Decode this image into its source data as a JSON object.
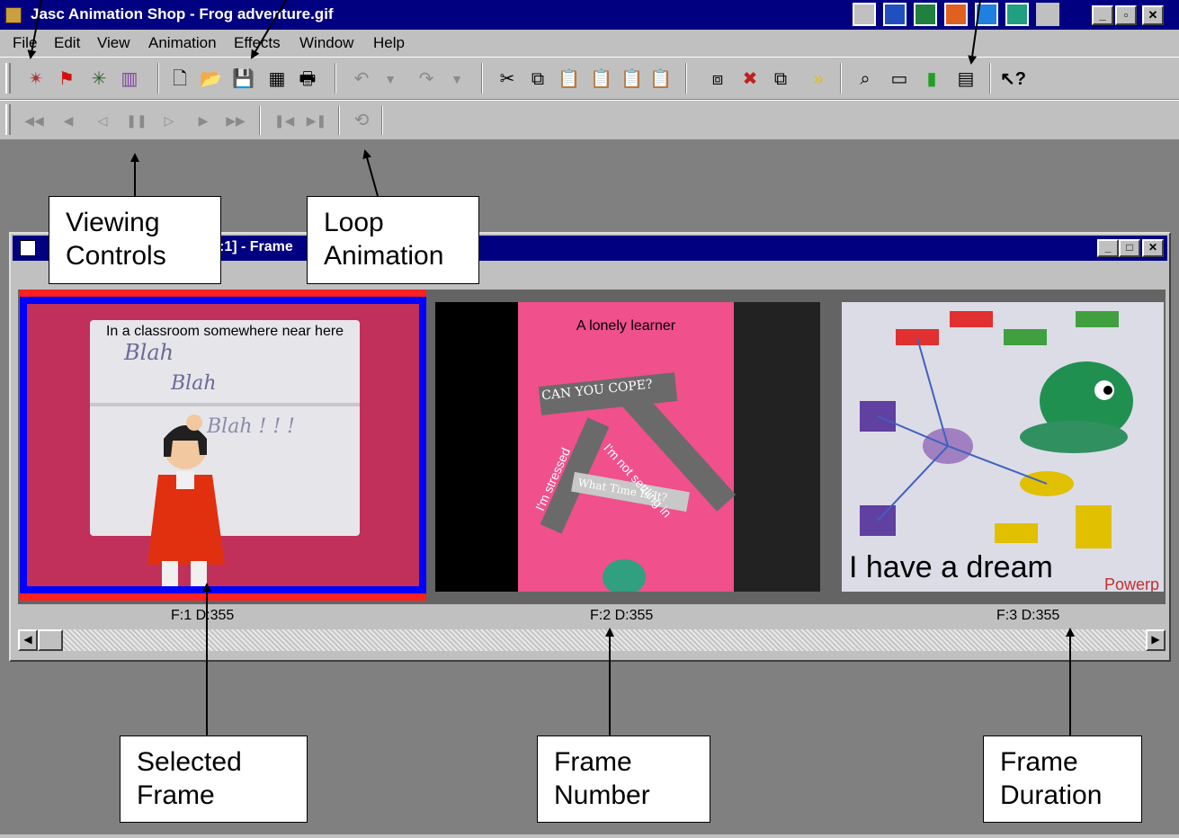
{
  "window": {
    "title": "Jasc Animation Shop - Frog adventure.gif",
    "controls": {
      "minimize": "_",
      "restore": "▫",
      "close": "✕"
    }
  },
  "menu": [
    "File",
    "Edit",
    "View",
    "Animation",
    "Effects",
    "Window",
    "Help"
  ],
  "child_window": {
    "title": ":1] - Frame",
    "controls": {
      "minimize": "_",
      "maximize": "□",
      "close": "✕"
    }
  },
  "frames": [
    {
      "caption": "F:1  D:355",
      "text": "In a classroom somewhere near here",
      "handwriting": [
        "Blah",
        "Blah",
        "Blah ! ! !"
      ]
    },
    {
      "caption": "F:2  D:355",
      "text": "A lonely learner",
      "signs": [
        "CAN YOU COPE?",
        "I'm not settling in",
        "I'm stressed",
        "What Time Is It?"
      ]
    },
    {
      "caption": "F:3  D:355",
      "text": "I have a dream",
      "corner_text": "Powerp"
    }
  ],
  "scrollbar": {
    "left_arrow": "◀",
    "right_arrow": "▶"
  },
  "annotations": {
    "viewing_controls": "Viewing\nControls",
    "loop_animation": "Loop\nAnimation",
    "selected_frame": "Selected\nFrame",
    "frame_number": "Frame\nNumber",
    "frame_duration": "Frame\nDuration"
  },
  "colors": {
    "title_bar": "#000080",
    "face": "#c0c0c0",
    "workspace": "#808080",
    "selection_outer": "#ff2020",
    "selection_inner": "#0000ff"
  }
}
